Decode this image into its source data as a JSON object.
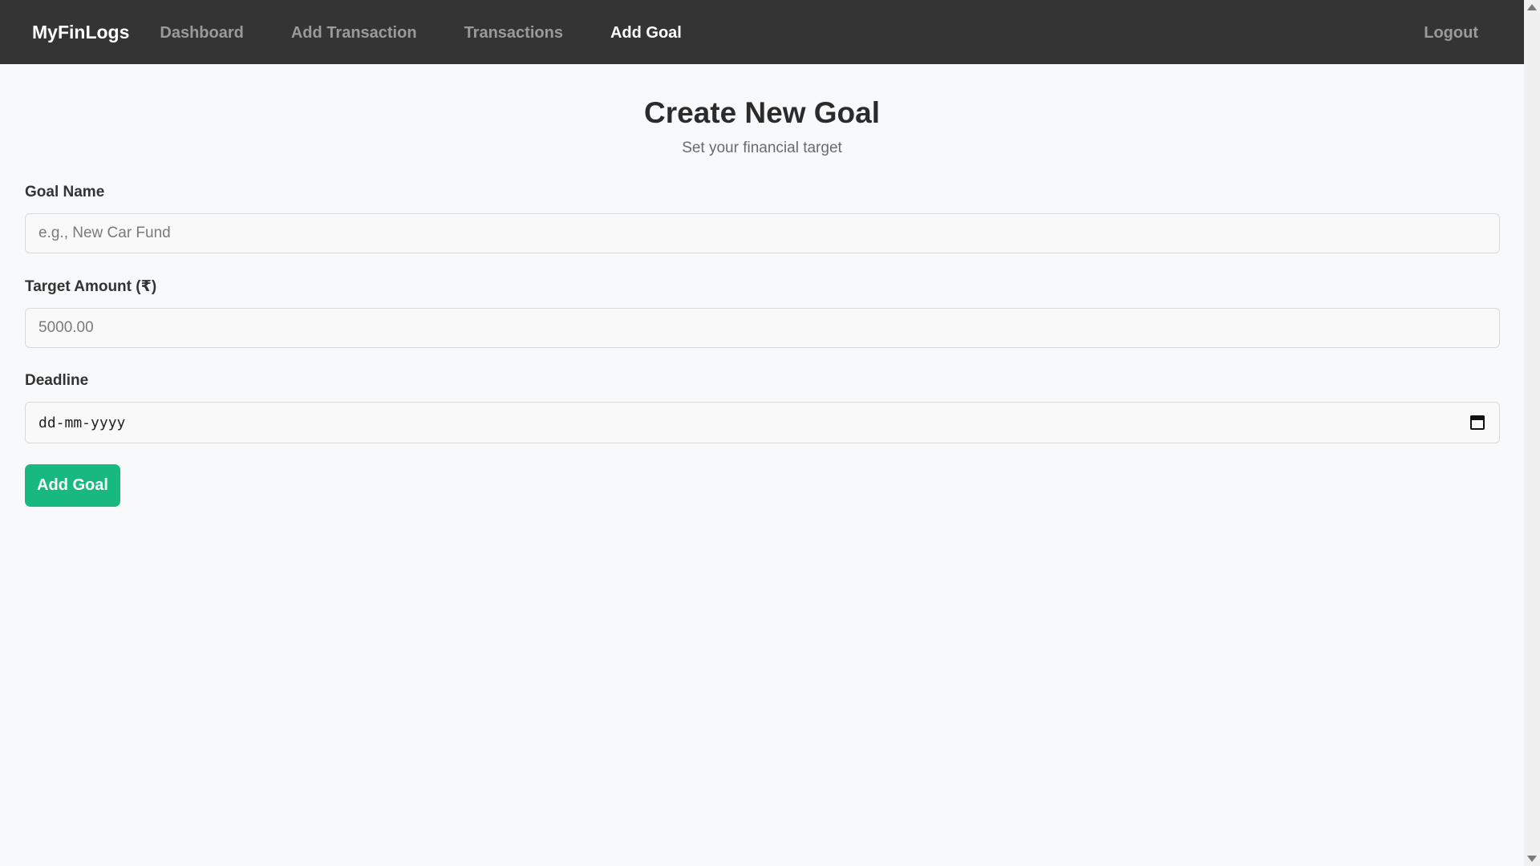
{
  "navbar": {
    "brand": "MyFinLogs",
    "links": [
      {
        "label": "Dashboard",
        "active": false
      },
      {
        "label": "Add Transaction",
        "active": false
      },
      {
        "label": "Transactions",
        "active": false
      },
      {
        "label": "Add Goal",
        "active": true
      }
    ],
    "logout": "Logout"
  },
  "page": {
    "title": "Create New Goal",
    "subtitle": "Set your financial target"
  },
  "form": {
    "goal_name": {
      "label": "Goal Name",
      "value": "",
      "placeholder": "e.g., New Car Fund"
    },
    "target_amount": {
      "label": "Target Amount (₹)",
      "value": "",
      "placeholder": "5000.00"
    },
    "deadline": {
      "label": "Deadline",
      "value": "",
      "placeholder": "dd-mm-yyyy",
      "icon": "calendar-icon"
    },
    "submit_label": "Add Goal"
  },
  "colors": {
    "navbar_bg": "#343434",
    "accent": "#17b97e",
    "page_bg": "#f8f9fa"
  }
}
